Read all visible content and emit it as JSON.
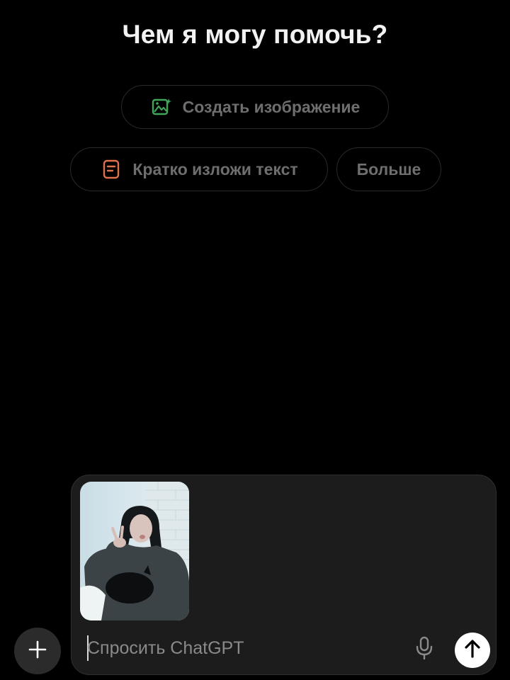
{
  "header": {
    "title": "Чем я могу помочь?"
  },
  "suggestions": [
    {
      "label": "Создать изображение",
      "icon": "create-image-icon",
      "icon_color": "#3fa65c"
    },
    {
      "label": "Кратко изложи текст",
      "icon": "document-icon",
      "icon_color": "#e0714f"
    },
    {
      "label": "Больше"
    }
  ],
  "composer": {
    "placeholder": "Спросить ChatGPT",
    "value": "",
    "attachment": {
      "type": "image",
      "icon": "photo-attachment"
    },
    "mic_icon": "microphone-icon",
    "send_icon": "arrow-up-icon"
  },
  "add_button": {
    "icon": "plus-icon"
  },
  "colors": {
    "background": "#000000",
    "composer_bg": "#1c1c1c",
    "chip_text": "#6e6e6e",
    "send_bg": "#ffffff"
  }
}
